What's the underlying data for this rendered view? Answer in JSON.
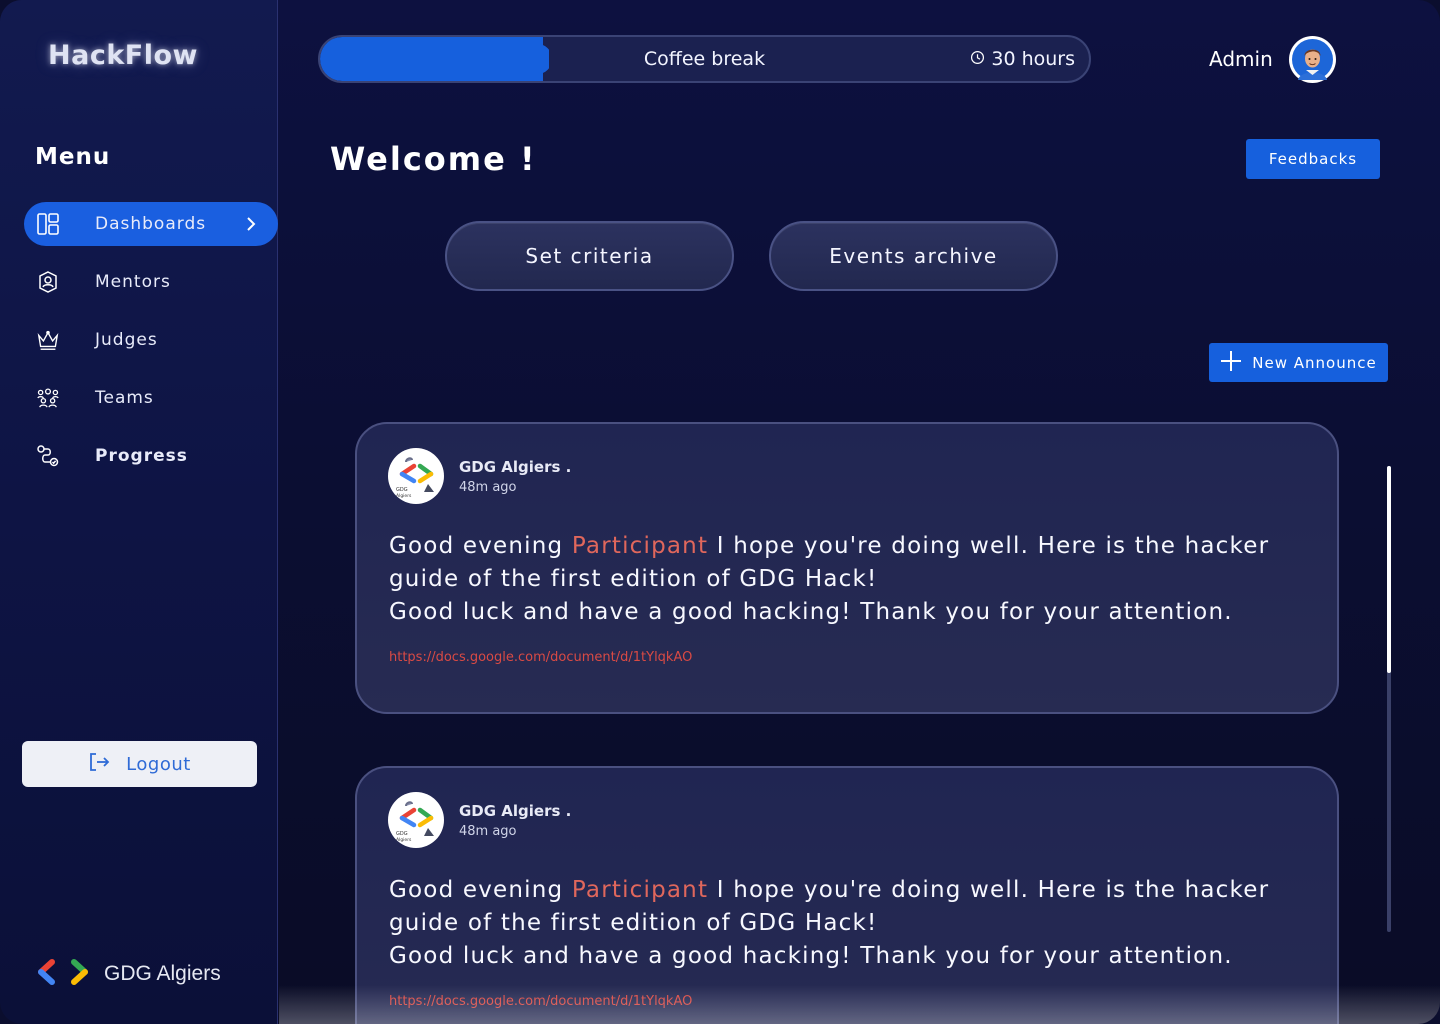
{
  "app": {
    "logo_text": "HackFlow",
    "org_name": "GDG Algiers"
  },
  "sidebar": {
    "menu_title": "Menu",
    "items": [
      {
        "label": "Dashboards",
        "icon": "dashboard-icon",
        "active": true
      },
      {
        "label": "Mentors",
        "icon": "mentor-icon"
      },
      {
        "label": "Judges",
        "icon": "crown-icon"
      },
      {
        "label": "Teams",
        "icon": "teams-icon"
      },
      {
        "label": "Progress",
        "icon": "progress-icon"
      }
    ],
    "logout_label": "Logout"
  },
  "topbar": {
    "status_label": "Coffee break",
    "time_remaining": "30 hours",
    "progress": 0.29,
    "user_name": "Admin"
  },
  "main": {
    "welcome": "Welcome !",
    "feedbacks_label": "Feedbacks",
    "set_criteria_label": "Set criteria",
    "events_archive_label": "Events archive",
    "new_announce_label": "New Announce"
  },
  "announcements": [
    {
      "author": "GDG Algiers .",
      "time": "48m ago",
      "greeting": "Good evening",
      "highlight": "Participant",
      "body_1": " I hope you're doing well. Here is the hacker guide of the first edition of GDG Hack!",
      "body_2": "Good luck and have a good hacking!  Thank you for your attention.",
      "link": "https://docs.google.com/document/d/1tYlqkAO"
    },
    {
      "author": "GDG Algiers .",
      "time": "48m ago",
      "greeting": "Good evening",
      "highlight": "Participant",
      "body_1": " I hope you're doing well. Here is the hacker guide of the first edition of GDG Hack!",
      "body_2": "Good luck and have a good hacking!  Thank you for your attention.",
      "link": "https://docs.google.com/document/d/1tYlqkAO"
    }
  ],
  "colors": {
    "accent": "#1660dd",
    "highlight": "#e0675c",
    "link": "#d94a44"
  }
}
